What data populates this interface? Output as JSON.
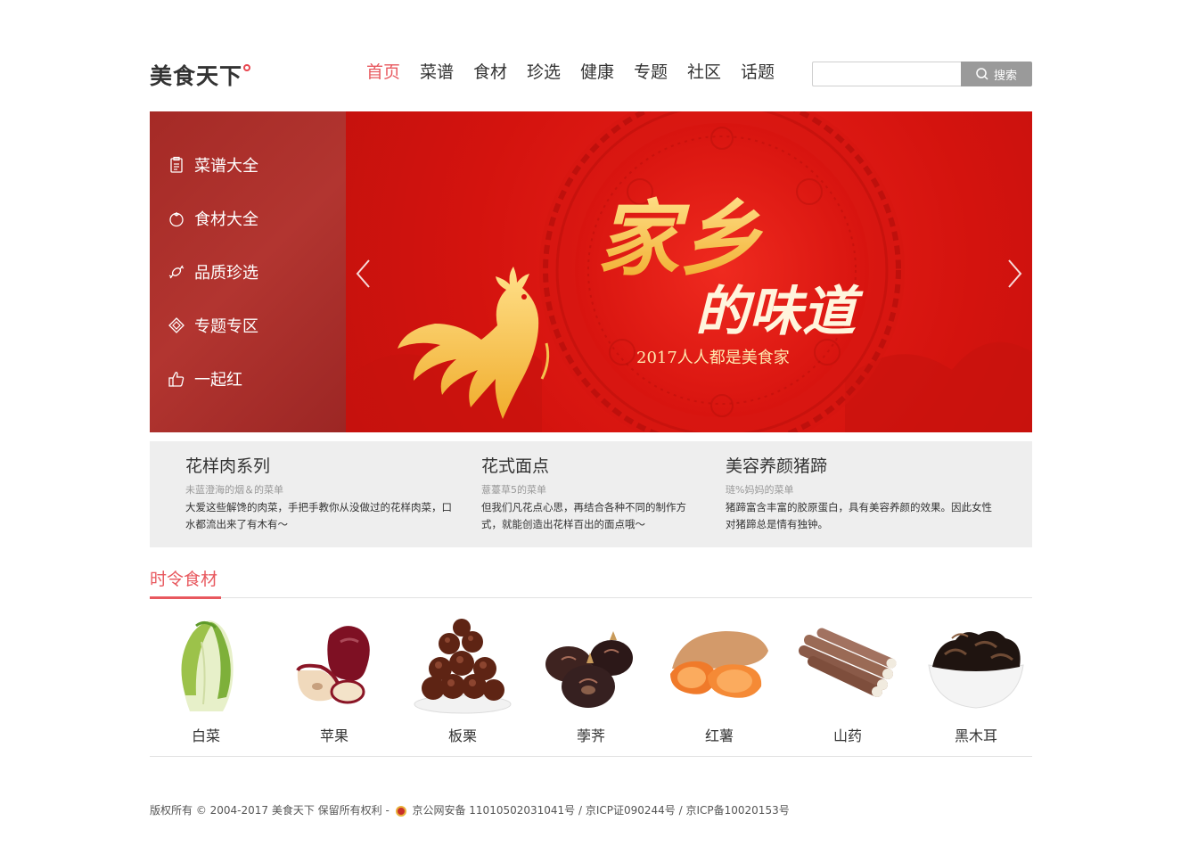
{
  "header": {
    "logo": "美食天下",
    "nav": [
      "首页",
      "菜谱",
      "食材",
      "珍选",
      "健康",
      "专题",
      "社区",
      "话题"
    ],
    "search": {
      "placeholder": "",
      "button_label": "搜索"
    }
  },
  "banner": {
    "sidebar": [
      {
        "label": "菜谱大全",
        "icon": "clipboard-icon"
      },
      {
        "label": "食材大全",
        "icon": "tomato-icon"
      },
      {
        "label": "品质珍选",
        "icon": "candy-icon"
      },
      {
        "label": "专题专区",
        "icon": "diamond-icon"
      },
      {
        "label": "一起红",
        "icon": "thumbs-up-icon"
      }
    ],
    "slide": {
      "headline_1": "家乡",
      "headline_2": "的味道",
      "tagline": "2017人人都是美食家",
      "colors": {
        "bg": "#df1a14",
        "gold": "#f4c24e"
      }
    }
  },
  "featured": [
    {
      "title": "花样肉系列",
      "author": "未蓝澄海的烟＆的菜单",
      "desc": "大爱这些解馋的肉菜，手把手教你从没做过的花样肉菜，口水都流出来了有木有～"
    },
    {
      "title": "花式面点",
      "author": "薏薹草5的菜单",
      "desc": "但我们凡花点心思，再结合各种不同的制作方式，就能创造出花样百出的面点哦～"
    },
    {
      "title": "美容养颜猪蹄",
      "author": "琏%妈妈的菜单",
      "desc": "猪蹄富含丰富的胶原蛋白，具有美容养颜的效果。因此女性对猪蹄总是情有独钟。"
    }
  ],
  "seasonal": {
    "title": "时令食材",
    "items": [
      {
        "name": "白菜",
        "icon": "cabbage-icon"
      },
      {
        "name": "苹果",
        "icon": "apple-icon"
      },
      {
        "name": "板栗",
        "icon": "chestnut-icon"
      },
      {
        "name": "荸荠",
        "icon": "water-chestnut-icon"
      },
      {
        "name": "红薯",
        "icon": "sweet-potato-icon"
      },
      {
        "name": "山药",
        "icon": "yam-icon"
      },
      {
        "name": "黑木耳",
        "icon": "black-fungus-icon"
      }
    ]
  },
  "footer": {
    "copyright": "版权所有 © 2004-2017 美食天下 保留所有权利 -",
    "beian": "京公网安备 11010502031041号 / 京ICP证090244号 / 京ICP备10020153号"
  },
  "colors": {
    "accent": "#e8585e",
    "sidebar": "#a52a26",
    "search_button": "#9a9a9a",
    "featured_bg": "#eeeeee"
  }
}
